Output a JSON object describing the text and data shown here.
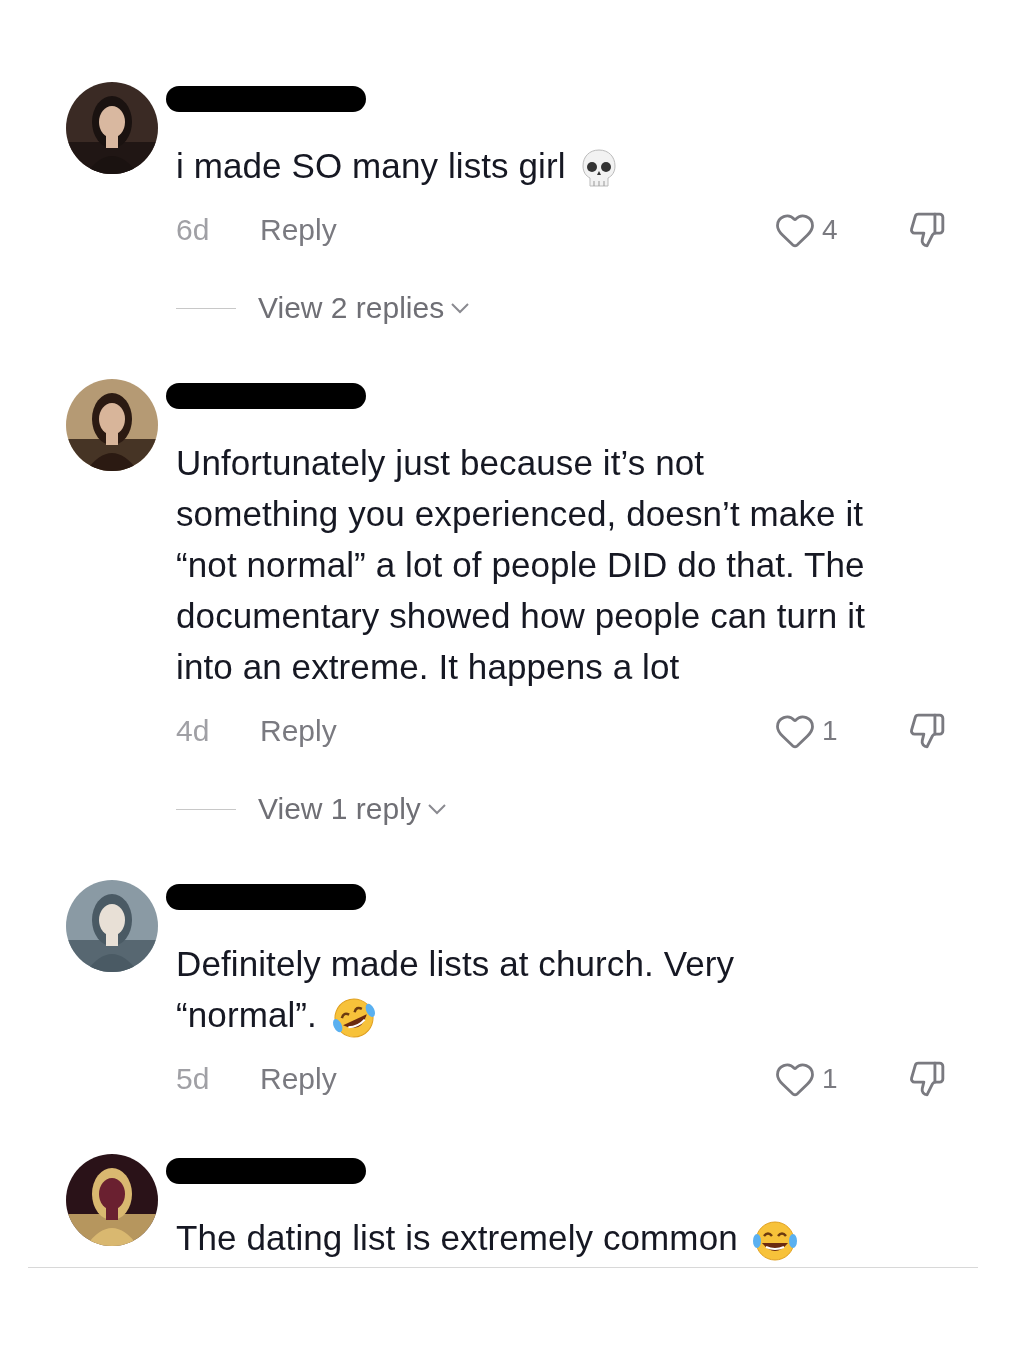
{
  "comments": [
    {
      "username_redacted": true,
      "text": "i made SO many lists girl",
      "emoji": {
        "kind": "skull"
      },
      "time": "6d",
      "reply": "Reply",
      "likes": "4",
      "replies": "View 2 replies"
    },
    {
      "username_redacted": true,
      "text": "Unfortunately just because it’s not something you experienced, doesn’t make it “not normal” a lot of people DID do that. The documentary showed how people can turn it into an extreme. It happens a lot",
      "time": "4d",
      "reply": "Reply",
      "likes": "1",
      "replies": "View 1 reply"
    },
    {
      "username_redacted": true,
      "text": "Definitely made lists at church. Very “normal”.",
      "emoji": {
        "kind": "rofl"
      },
      "time": "5d",
      "reply": "Reply",
      "likes": "1"
    },
    {
      "username_redacted": true,
      "text": "The dating list is extremely common",
      "emoji": {
        "kind": "joy"
      }
    }
  ]
}
